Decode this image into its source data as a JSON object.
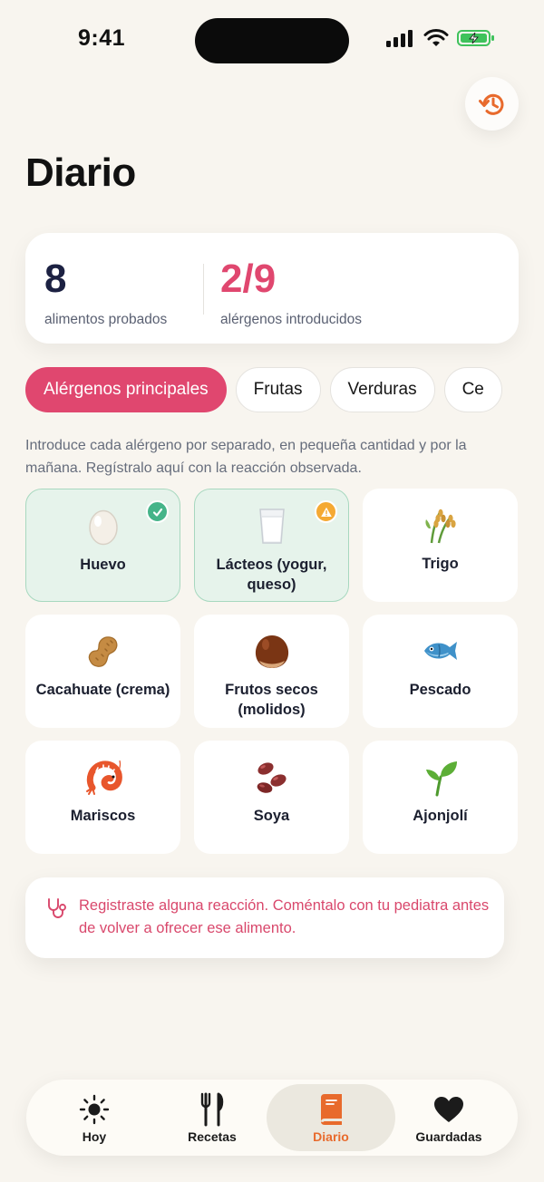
{
  "status_bar": {
    "time": "9:41"
  },
  "page": {
    "title": "Diario"
  },
  "stats": {
    "tried_value": "8",
    "tried_label": "alimentos probados",
    "allergens_value": "2/9",
    "allergens_label": "alérgenos introducidos"
  },
  "chips": [
    {
      "label": "Alérgenos principales",
      "active": true
    },
    {
      "label": "Frutas",
      "active": false
    },
    {
      "label": "Verduras",
      "active": false
    },
    {
      "label": "Ce",
      "active": false
    }
  ],
  "intro_text": "Introduce cada alérgeno por separado, en pequeña cantidad y por la mañana. Regístralo aquí con la reacción observada.",
  "allergens": [
    {
      "label": "Huevo",
      "icon": "egg-icon",
      "status": "ok"
    },
    {
      "label": "Lácteos (yogur, queso)",
      "icon": "milk-icon",
      "status": "warning"
    },
    {
      "label": "Trigo",
      "icon": "wheat-icon",
      "status": "none"
    },
    {
      "label": "Cacahuate (crema)",
      "icon": "peanut-icon",
      "status": "none"
    },
    {
      "label": "Frutos secos (molidos)",
      "icon": "chestnut-icon",
      "status": "none"
    },
    {
      "label": "Pescado",
      "icon": "fish-icon",
      "status": "none"
    },
    {
      "label": "Mariscos",
      "icon": "shrimp-icon",
      "status": "none"
    },
    {
      "label": "Soya",
      "icon": "beans-icon",
      "status": "none"
    },
    {
      "label": "Ajonjolí",
      "icon": "seedling-icon",
      "status": "none"
    }
  ],
  "reaction_note": "Registraste alguna reacción. Coméntalo con tu pediatra antes de volver a ofrecer ese alimento.",
  "tabs": [
    {
      "label": "Hoy",
      "icon": "sun-icon",
      "active": false
    },
    {
      "label": "Recetas",
      "icon": "fork-knife-icon",
      "active": false
    },
    {
      "label": "Diario",
      "icon": "book-icon",
      "active": true
    },
    {
      "label": "Guardadas",
      "icon": "heart-icon",
      "active": false
    }
  ],
  "colors": {
    "background": "#f8f5ef",
    "accent_pink": "#e0476f",
    "accent_orange": "#e86a2c",
    "success_green": "#45b489",
    "warning_amber": "#f5a933",
    "tile_done_bg": "#e6f3eb"
  }
}
